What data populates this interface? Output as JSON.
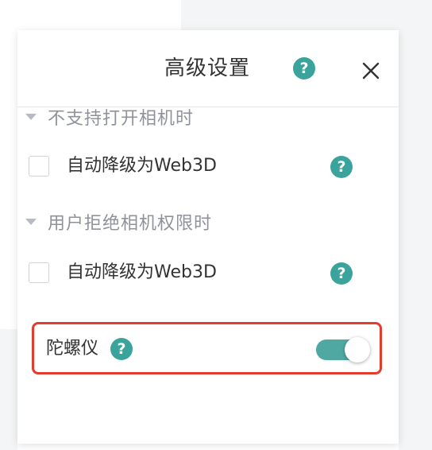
{
  "dialog": {
    "title": "高级设置",
    "help_glyph": "?"
  },
  "sections": [
    {
      "heading": "不支持打开相机时",
      "option": {
        "label": "自动降级为Web3D",
        "checked": false,
        "help_glyph": "?"
      }
    },
    {
      "heading": "用户拒绝相机权限时",
      "option": {
        "label": "自动降级为Web3D",
        "checked": false,
        "help_glyph": "?"
      }
    }
  ],
  "gyroscope": {
    "label": "陀螺仪",
    "enabled": true,
    "help_glyph": "?"
  },
  "icons": {
    "help": "question-circle-icon",
    "close": "close-icon",
    "caret": "caret-down-icon"
  },
  "colors": {
    "accent": "#3aa39b",
    "toggle_on": "#4fa9a2",
    "highlight_border": "#e23c2f",
    "title_text": "#333333",
    "section_text": "#8f9399"
  }
}
